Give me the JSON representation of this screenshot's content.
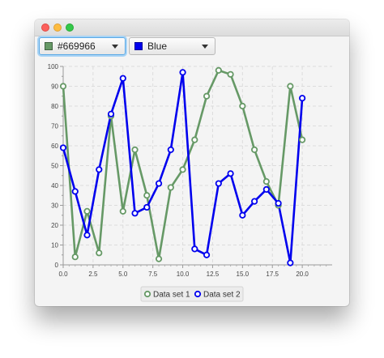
{
  "window": {
    "controls": [
      "close",
      "minimize",
      "zoom"
    ]
  },
  "toolbar": {
    "color_combo_1": {
      "label": "#669966",
      "swatch": "#669966"
    },
    "color_combo_2": {
      "label": "Blue",
      "swatch": "#0000ee"
    }
  },
  "chart_data": {
    "type": "line",
    "title": "",
    "xlabel": "",
    "ylabel": "",
    "xlim": [
      0,
      22.5
    ],
    "ylim": [
      0,
      100
    ],
    "x_ticks": [
      "0.0",
      "2.5",
      "5.0",
      "7.5",
      "10.0",
      "12.5",
      "15.0",
      "17.5",
      "20.0"
    ],
    "y_ticks": [
      "0",
      "10",
      "20",
      "30",
      "40",
      "50",
      "60",
      "70",
      "80",
      "90",
      "100"
    ],
    "grid": true,
    "legend_position": "bottom",
    "x": [
      0,
      1,
      2,
      3,
      4,
      5,
      6,
      7,
      8,
      9,
      10,
      11,
      12,
      13,
      14,
      15,
      16,
      17,
      18,
      19,
      20
    ],
    "series": [
      {
        "name": "Data set 1",
        "color": "#669966",
        "values": [
          90,
          4,
          27,
          6,
          75,
          27,
          58,
          35,
          3,
          39,
          48,
          63,
          85,
          98,
          96,
          80,
          58,
          42,
          30,
          90,
          63
        ]
      },
      {
        "name": "Data set 2",
        "color": "#0000ee",
        "values": [
          59,
          37,
          15,
          48,
          76,
          94,
          26,
          29,
          41,
          58,
          97,
          8,
          5,
          41,
          46,
          25,
          32,
          38,
          31,
          1,
          84
        ]
      }
    ]
  }
}
